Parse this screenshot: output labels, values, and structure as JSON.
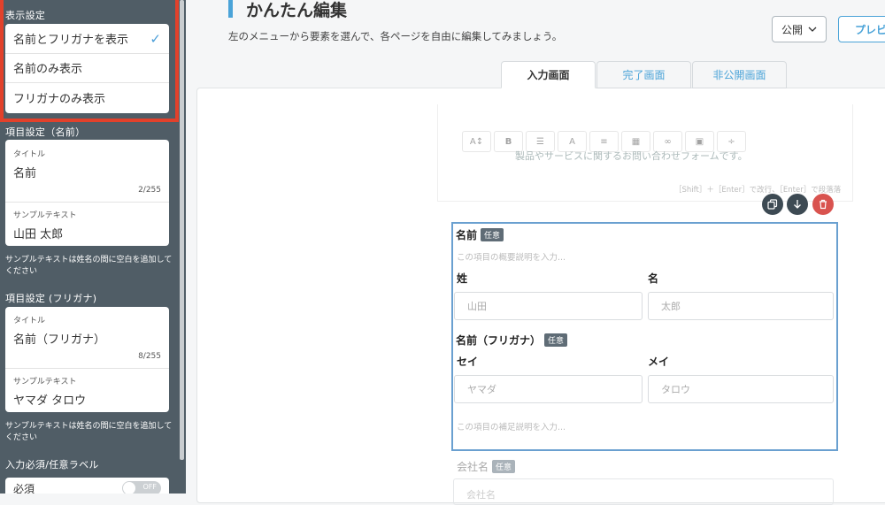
{
  "sidebar": {
    "display_settings": {
      "heading": "表示設定",
      "options": [
        "名前とフリガナを表示",
        "名前のみ表示",
        "フリガナのみ表示"
      ],
      "selected_mark": "✓"
    },
    "name_settings": {
      "heading": "項目設定（名前）",
      "title_label": "タイトル",
      "title_value": "名前",
      "title_count": "2/255",
      "sample_label": "サンプルテキスト",
      "sample_value": "山田 太郎",
      "note": "サンプルテキストは姓名の間に空白を追加してください"
    },
    "kana_settings": {
      "heading": "項目設定 (フリガナ)",
      "title_label": "タイトル",
      "title_value": "名前（フリガナ）",
      "title_count": "8/255",
      "sample_label": "サンプルテキスト",
      "sample_value": "ヤマダ タロウ",
      "note": "サンプルテキストは姓名の間に空白を追加してください"
    },
    "required_settings": {
      "heading": "入力必須/任意ラベル",
      "row_label": "必須",
      "toggle_text": "OFF"
    }
  },
  "header": {
    "title": "かんたん編集",
    "description": "左のメニューから要素を選んで、各ページを自由に編集してみましょう。",
    "publish_label": "公開",
    "preview_label": "プレビ"
  },
  "tabs": [
    "入力画面",
    "完了画面",
    "非公開画面"
  ],
  "editor": {
    "toolbar": [
      "A↕",
      "B",
      "☰",
      "A",
      "≡",
      "▦",
      "∞",
      "▣",
      "÷"
    ],
    "text": "製品やサービスに関するお問い合わせフォームです。",
    "hint": "［Shift］＋［Enter］で改行、［Enter］で段落落"
  },
  "name_block": {
    "name_label": "名前",
    "optional_badge": "任意",
    "desc_placeholder": "この項目の概要説明を入力...",
    "last_label": "姓",
    "first_label": "名",
    "last_placeholder": "山田",
    "first_placeholder": "太郎",
    "kana_label": "名前（フリガナ）",
    "kana_badge": "任意",
    "kana_last_label": "セイ",
    "kana_first_label": "メイ",
    "kana_last_placeholder": "ヤマダ",
    "kana_first_placeholder": "タロウ",
    "sub_placeholder": "この項目の補足説明を入力..."
  },
  "company_block": {
    "label": "会社名",
    "badge": "任意",
    "placeholder": "会社名"
  },
  "colors": {
    "accent": "#4aa3d8",
    "sidebar": "#505d66",
    "highlight": "#e2412b",
    "delete": "#d9534f"
  }
}
